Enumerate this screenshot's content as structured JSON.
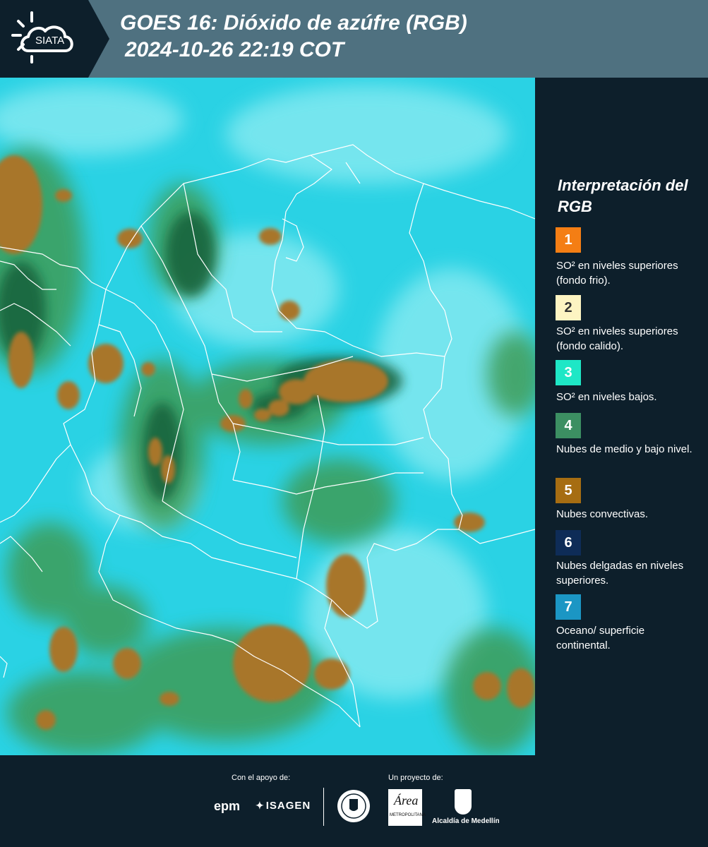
{
  "header": {
    "brand": "SIATA",
    "title_line1": "GOES 16: Dióxido de azúfre (RGB)",
    "title_line2": "2024-10-26 22:19 COT"
  },
  "legend": {
    "title": "Interpretación del RGB",
    "items": [
      {
        "number": "1",
        "color": "#f47e14",
        "label": "SO² en niveles superiores (fondo frio)."
      },
      {
        "number": "2",
        "color": "#fdf4c2",
        "label": "SO² en niveles superiores (fondo calido)."
      },
      {
        "number": "3",
        "color": "#1ee7c6",
        "label": "SO² en niveles bajos."
      },
      {
        "number": "4",
        "color": "#3c8f62",
        "label": "Nubes de medio y bajo nivel."
      },
      {
        "number": "5",
        "color": "#a66d12",
        "label": "Nubes convectivas."
      },
      {
        "number": "6",
        "color": "#0e2c57",
        "label": "Nubes delgadas en niveles superiores."
      },
      {
        "number": "7",
        "color": "#1b96c4",
        "label": "Oceano/ superficie continental."
      }
    ]
  },
  "footer": {
    "support_caption": "Con el apoyo de:",
    "project_caption": "Un proyecto de:",
    "sponsors": [
      "epm",
      "ISAGEN"
    ],
    "partners": [
      "Área Metropolitana Valle de Aburrá",
      "Alcaldía de Medellín"
    ],
    "alcaldia_label": "Alcaldía de Medellín",
    "area_label": "Área",
    "area_sublabel": "METROPOLITANA"
  },
  "map": {
    "colors": {
      "background": "#2ad2e4",
      "cloud_low": "#6fe6ee",
      "cloud_mid": "#3e9c58",
      "cloud_dark": "#17603a",
      "convective": "#a8762a",
      "border": "#ffffff"
    }
  }
}
